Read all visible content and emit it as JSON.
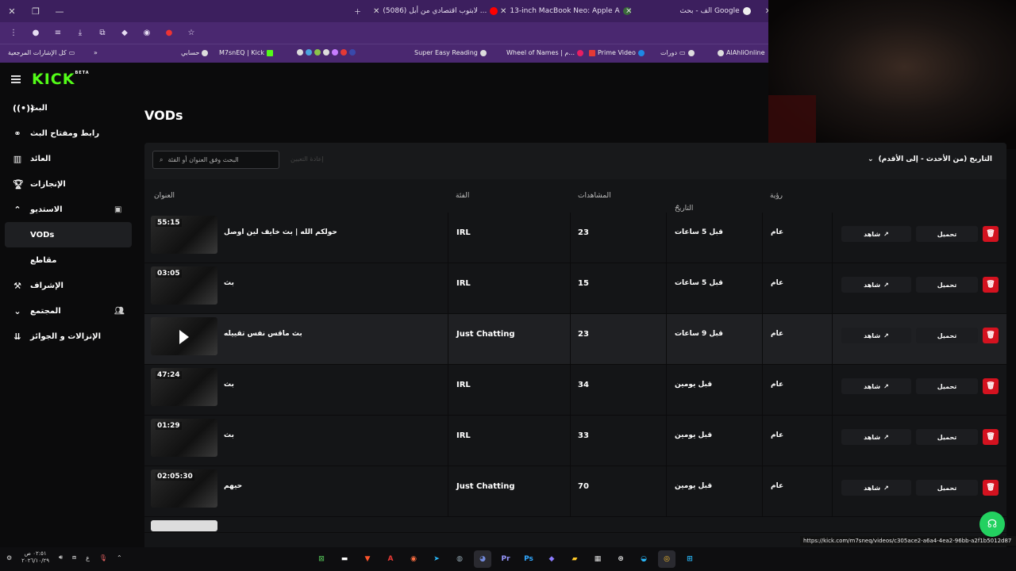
{
  "browser": {
    "tabs": [
      {
        "title": "(5086) لابتوب اقتصادي من أبل ... ",
        "favicon_color": "#ff0000"
      },
      {
        "title": "13-inch MacBook Neo: Apple A",
        "favicon_color": "#888888"
      },
      {
        "title": "الف - بحث Google",
        "favicon_color": "#ffffff"
      }
    ],
    "bookmarks": [
      {
        "label": "كل الإشارات المرجعية"
      },
      {
        "label": "حسابي"
      },
      {
        "label": "M7snEQ | Kick"
      },
      {
        "label": "Super Easy Reading"
      },
      {
        "label": "Wheel of Names | م..."
      },
      {
        "label": "Prime Video"
      },
      {
        "label": "دورات"
      },
      {
        "label": "AlAhliOnline"
      }
    ]
  },
  "kick": {
    "logo": "KICK",
    "logo_badge": "BETA",
    "nav": [
      {
        "label": "البث",
        "icon": "broadcast-icon"
      },
      {
        "label": "رابط ومفتاح البث",
        "icon": "link-icon"
      },
      {
        "label": "العائد",
        "icon": "chart-icon"
      },
      {
        "label": "الإنجازات",
        "icon": "trophy-icon"
      },
      {
        "label": "الاستديو",
        "icon": "studio-icon"
      },
      {
        "label": "VODs",
        "icon": ""
      },
      {
        "label": "مقاطع",
        "icon": ""
      },
      {
        "label": "الإشراف",
        "icon": "gavel-icon"
      },
      {
        "label": "المجتمع",
        "icon": "community-icon"
      },
      {
        "label": "الإنزالات و الجوائز",
        "icon": "gift-icon"
      }
    ]
  },
  "page": {
    "title": "VODs",
    "search_placeholder": "البحث وفق العنوان أو الفئة",
    "reset_label": "إعادة التعيين",
    "sort_label": "التاريخ (من الأحدث - إلى الأقدم)"
  },
  "table": {
    "headers": {
      "title": "العنوان",
      "category": "الفئة",
      "views": "المشاهدات",
      "date": "التاريخ",
      "visibility": "رؤية"
    },
    "watch_label": "شاهد",
    "download_label": "تحميل",
    "rows": [
      {
        "duration": "55:15",
        "title": "حولكم الله | بث خايف لين اوصل",
        "category": "IRL",
        "views": "23",
        "date": "قبل 5 ساعات",
        "visibility": "عام"
      },
      {
        "duration": "03:05",
        "title": "بث",
        "category": "IRL",
        "views": "15",
        "date": "قبل 5 ساعات",
        "visibility": "عام"
      },
      {
        "duration": "",
        "title": "بث ماقس نفس تقييله",
        "category": "Just Chatting",
        "views": "23",
        "date": "قبل 9 ساعات",
        "visibility": "عام"
      },
      {
        "duration": "47:24",
        "title": "بث",
        "category": "IRL",
        "views": "34",
        "date": "قبل يومين",
        "visibility": "عام"
      },
      {
        "duration": "01:29",
        "title": "بث",
        "category": "IRL",
        "views": "33",
        "date": "قبل يومين",
        "visibility": "عام"
      },
      {
        "duration": "02:05:30",
        "title": "حيهم",
        "category": "Just Chatting",
        "views": "70",
        "date": "قبل يومين",
        "visibility": "عام"
      }
    ]
  },
  "status_url": "https://kick.com/m7sneq/videos/c305ace2-a6a4-4ea2-96bb-a2f1b5012d87",
  "taskbar": {
    "time": "٠٢:٥١ ص",
    "date": "٢٠٢٦/١٠/٢٩",
    "lang": "ع"
  },
  "colors": {
    "accent": "#53fc18",
    "delete": "#d3121f",
    "browser": "#4a2870"
  }
}
